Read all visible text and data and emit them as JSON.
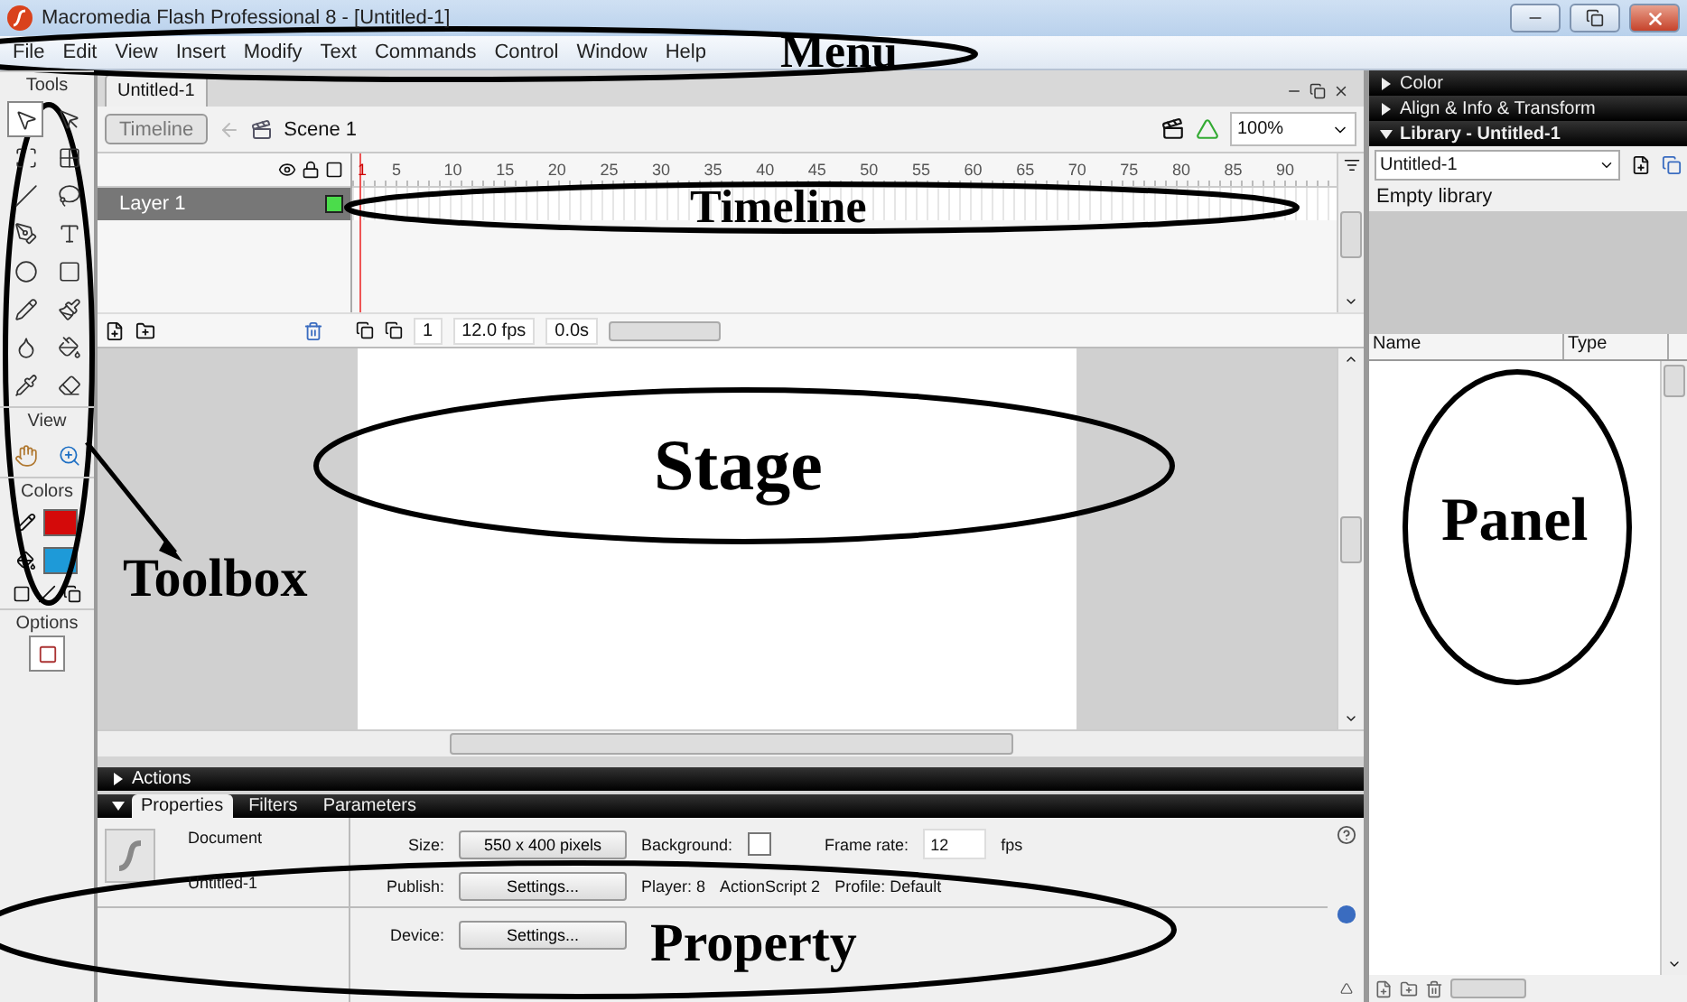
{
  "window": {
    "title": "Macromedia Flash Professional 8 - [Untitled-1]"
  },
  "menu": [
    "File",
    "Edit",
    "View",
    "Insert",
    "Modify",
    "Text",
    "Commands",
    "Control",
    "Window",
    "Help"
  ],
  "toolbox": {
    "title": "Tools",
    "view_title": "View",
    "colors_title": "Colors",
    "options_title": "Options",
    "colors": [
      {
        "kind": "stroke",
        "color": "#d40a0a"
      },
      {
        "kind": "fill",
        "color": "#1e9ad8"
      }
    ]
  },
  "document": {
    "tab": "Untitled-1",
    "timeline_button": "Timeline",
    "scene": "Scene 1",
    "zoom": "100%"
  },
  "timeline": {
    "ruler": [
      "1",
      "5",
      "10",
      "15",
      "20",
      "25",
      "30",
      "35",
      "40",
      "45",
      "50",
      "55",
      "60",
      "65",
      "70",
      "75",
      "80",
      "85",
      "90"
    ],
    "layers": [
      {
        "name": "Layer 1",
        "selected": true
      }
    ],
    "current_frame": "1",
    "frame_rate": "12.0 fps",
    "elapsed": "0.0s"
  },
  "panels": {
    "actions": "Actions",
    "property_tabs": [
      {
        "label": "Properties",
        "selected": true
      },
      {
        "label": "Filters",
        "selected": false
      },
      {
        "label": "Parameters",
        "selected": false
      }
    ]
  },
  "properties": {
    "type": "Document",
    "name": "Untitled-1",
    "size_label": "Size:",
    "size": "550 x 400 pixels",
    "background_label": "Background:",
    "frame_rate_label": "Frame rate:",
    "frame_rate": "12",
    "fps": "fps",
    "publish_label": "Publish:",
    "publish_button": "Settings...",
    "player": "Player: 8",
    "actionscript": "ActionScript  2",
    "profile": "Profile:  Default",
    "device_label": "Device:",
    "device_button": "Settings..."
  },
  "right_panel": {
    "sections": [
      {
        "title": "Color",
        "expanded": false
      },
      {
        "title": "Align & Info & Transform",
        "expanded": false
      },
      {
        "title": "Library - Untitled-1",
        "expanded": true
      }
    ],
    "library_select": "Untitled-1",
    "empty_text": "Empty library",
    "columns": [
      "Name",
      "Type"
    ]
  },
  "annotations": [
    {
      "label": "Menu",
      "kind": "menu"
    },
    {
      "label": "Timeline",
      "kind": "timeline"
    },
    {
      "label": "Stage",
      "kind": "stage"
    },
    {
      "label": "Toolbox",
      "kind": "toolbox"
    },
    {
      "label": "Panel",
      "kind": "panel"
    },
    {
      "label": "Property",
      "kind": "property"
    }
  ]
}
